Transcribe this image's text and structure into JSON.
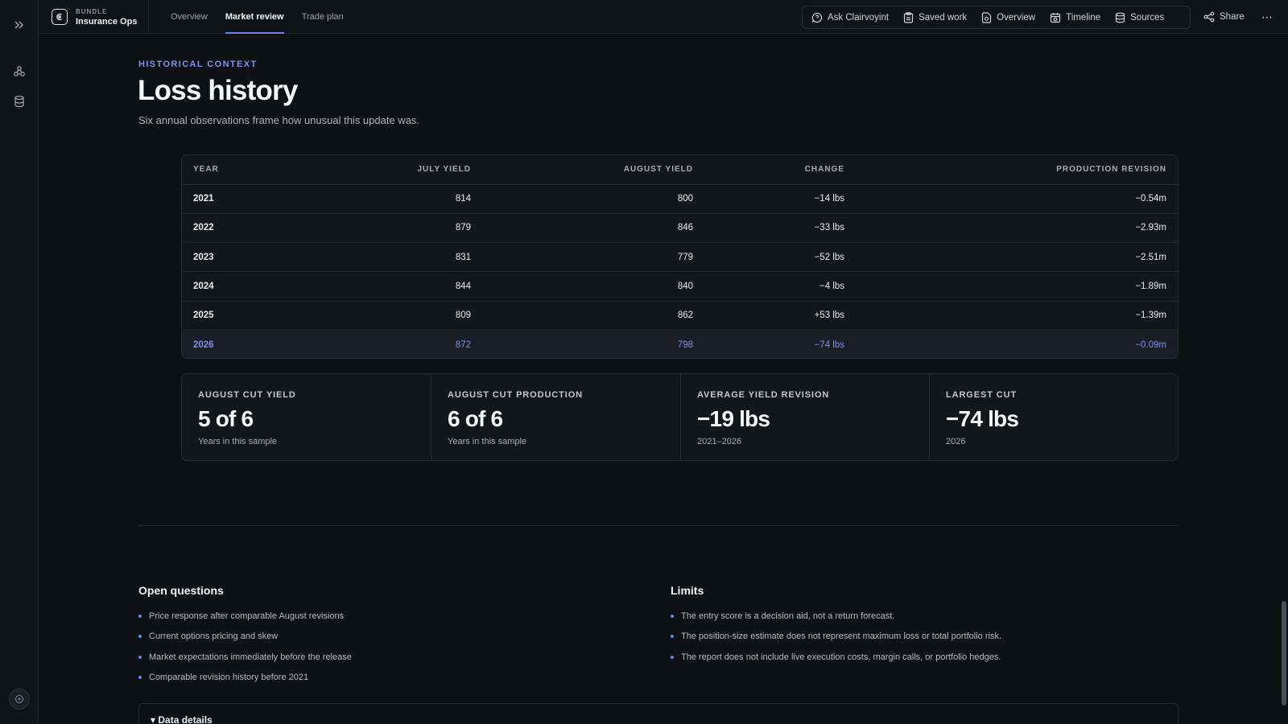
{
  "app": {
    "bundle_label": "BUNDLE",
    "workspace": "Insurance Ops"
  },
  "tabs": [
    {
      "label": "Overview",
      "active": false
    },
    {
      "label": "Market review",
      "active": true
    },
    {
      "label": "Trade plan",
      "active": false
    }
  ],
  "toolbar": {
    "ask": "Ask Clairvoyint",
    "saved": "Saved work",
    "overview": "Overview",
    "timeline": "Timeline",
    "sources": "Sources",
    "share": "Share",
    "more": "⋯"
  },
  "header": {
    "eyebrow": "HISTORICAL CONTEXT",
    "title": "Loss history",
    "subtitle": "Six annual observations frame how unusual this update was."
  },
  "table": {
    "columns": [
      "YEAR",
      "JULY YIELD",
      "AUGUST YIELD",
      "CHANGE",
      "PRODUCTION REVISION"
    ],
    "rows": [
      {
        "year": "2021",
        "july": "814",
        "august": "800",
        "change": "−14 lbs",
        "revision": "−0.54m",
        "highlight": false
      },
      {
        "year": "2022",
        "july": "879",
        "august": "846",
        "change": "−33 lbs",
        "revision": "−2.93m",
        "highlight": false
      },
      {
        "year": "2023",
        "july": "831",
        "august": "779",
        "change": "−52 lbs",
        "revision": "−2.51m",
        "highlight": false
      },
      {
        "year": "2024",
        "july": "844",
        "august": "840",
        "change": "−4 lbs",
        "revision": "−1.89m",
        "highlight": false
      },
      {
        "year": "2025",
        "july": "809",
        "august": "862",
        "change": "+53 lbs",
        "revision": "−1.39m",
        "highlight": false
      },
      {
        "year": "2026",
        "july": "872",
        "august": "798",
        "change": "−74 lbs",
        "revision": "−0.09m",
        "highlight": true
      }
    ]
  },
  "stats": [
    {
      "label": "AUGUST CUT YIELD",
      "value": "5 of 6",
      "note": "Years in this sample"
    },
    {
      "label": "AUGUST CUT PRODUCTION",
      "value": "6 of 6",
      "note": "Years in this sample"
    },
    {
      "label": "AVERAGE YIELD REVISION",
      "value": "−19 lbs",
      "note": "2021–2026"
    },
    {
      "label": "LARGEST CUT",
      "value": "−74 lbs",
      "note": "2026"
    }
  ],
  "open_questions": {
    "title": "Open questions",
    "items": [
      "Price response after comparable August revisions",
      "Current options pricing and skew",
      "Market expectations immediately before the release",
      "Comparable revision history before 2021"
    ]
  },
  "limits": {
    "title": "Limits",
    "items": [
      "The entry score is a decision aid, not a return forecast.",
      "The position-size estimate does not represent maximum loss or total portfolio risk.",
      "The report does not include live execution costs, margin calls, or portfolio hedges."
    ]
  },
  "details": {
    "label": "▾ Data details"
  },
  "colors": {
    "accent": "#7f92ef",
    "background": "#0f1115",
    "card": "#14161b"
  }
}
